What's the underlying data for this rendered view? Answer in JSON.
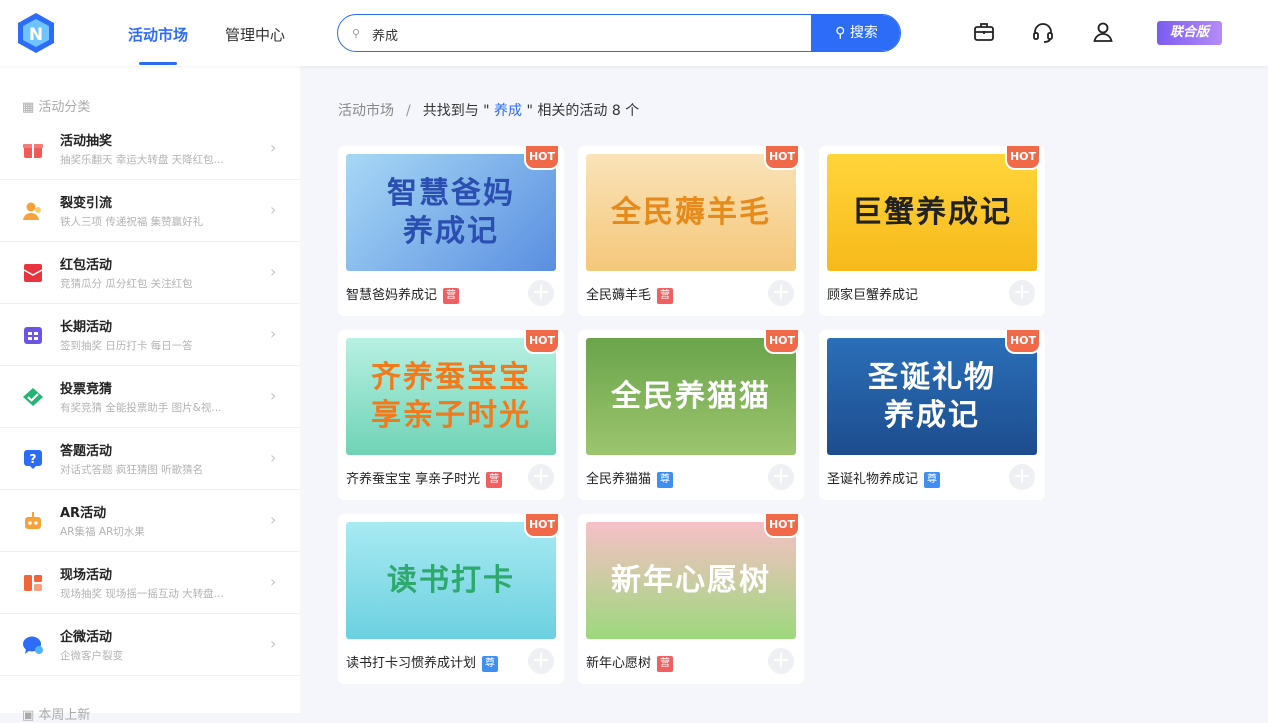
{
  "header": {
    "tabs": [
      {
        "label": "活动市场",
        "active": true
      },
      {
        "label": "管理中心",
        "active": false
      }
    ],
    "search": {
      "value": "养成",
      "button_label": "搜索"
    },
    "icons": [
      "briefcase-icon",
      "headset-icon",
      "user-icon"
    ],
    "edition_badge": "联合版"
  },
  "sidebar": {
    "heading": "活动分类",
    "items": [
      {
        "title": "活动抽奖",
        "subtitle": "抽奖乐翻天   幸运大转盘   天降红包...",
        "icon": "gift-icon",
        "color": "#f25a5a"
      },
      {
        "title": "裂变引流",
        "subtitle": "铁人三项   传递祝福   集赞赢好礼",
        "icon": "users-icon",
        "color": "#f5a23b"
      },
      {
        "title": "红包活动",
        "subtitle": "竞猜瓜分   瓜分红包   关注红包",
        "icon": "red-envelope-icon",
        "color": "#e8343f"
      },
      {
        "title": "长期活动",
        "subtitle": "签到抽奖   日历打卡   每日一答",
        "icon": "calendar-icon",
        "color": "#6c54e6"
      },
      {
        "title": "投票竞猜",
        "subtitle": "有奖竞猜   全能投票助手   图片&视...",
        "icon": "vote-icon",
        "color": "#23b573"
      },
      {
        "title": "答题活动",
        "subtitle": "对话式答题   疯狂猜图   听歌猜名",
        "icon": "question-icon",
        "color": "#2d6cf6"
      },
      {
        "title": "AR活动",
        "subtitle": "AR集福   AR切水果",
        "icon": "robot-icon",
        "color": "#f5a23b"
      },
      {
        "title": "现场活动",
        "subtitle": "现场抽奖   现场摇一摇互动   大转盘...",
        "icon": "layout-icon",
        "color": "#f2643a"
      },
      {
        "title": "企微活动",
        "subtitle": "企微客户裂变",
        "icon": "chat-icon",
        "color": "#2d6cf6"
      }
    ],
    "footer": "本周上新"
  },
  "breadcrumb": {
    "root": "活动市场",
    "separator": "/",
    "prefix": "共找到与 \"",
    "keyword": " 养成 ",
    "suffix": "\" 相关的活动 8 个"
  },
  "results": [
    {
      "name": "智慧爸妈养成记",
      "tag": "营",
      "tag_color": "red",
      "art": "智慧爸妈\n养成记",
      "bg": "linear-gradient(135deg,#a8d8f5,#5a8fe0)",
      "fg": "#2a4fb0"
    },
    {
      "name": "全民薅羊毛",
      "tag": "营",
      "tag_color": "red",
      "art": "全民薅羊毛",
      "bg": "linear-gradient(180deg,#f9e3b8,#f5c77a)",
      "fg": "#e78a1c"
    },
    {
      "name": "顾家巨蟹养成记",
      "tag": "",
      "tag_color": "",
      "art": "巨蟹养成记",
      "bg": "linear-gradient(180deg,#ffd53b,#f7b91a)",
      "fg": "#222"
    },
    {
      "name": "齐养蚕宝宝 享亲子时光",
      "tag": "营",
      "tag_color": "red",
      "art": "齐养蚕宝宝\n享亲子时光",
      "bg": "linear-gradient(180deg,#b7f0e2,#6fd3b6)",
      "fg": "#f07a1c"
    },
    {
      "name": "全民养猫猫",
      "tag": "尊",
      "tag_color": "blue",
      "art": "全民养猫猫",
      "bg": "linear-gradient(180deg,#6aa44b,#9cc56e)",
      "fg": "#fff"
    },
    {
      "name": "圣诞礼物养成记",
      "tag": "尊",
      "tag_color": "blue",
      "art": "圣诞礼物\n养成记",
      "bg": "linear-gradient(180deg,#2b6fb8,#1d4c8e)",
      "fg": "#fff"
    },
    {
      "name": "读书打卡习惯养成计划",
      "tag": "尊",
      "tag_color": "blue",
      "art": "读书打卡",
      "bg": "linear-gradient(180deg,#a8eaf2,#6cd0e0)",
      "fg": "#2ea86c"
    },
    {
      "name": "新年心愿树",
      "tag": "营",
      "tag_color": "red",
      "art": "新年心愿树",
      "bg": "linear-gradient(180deg,#f7c0c7,#9dd87c)",
      "fg": "#fff"
    }
  ],
  "hot_label": "HOT"
}
